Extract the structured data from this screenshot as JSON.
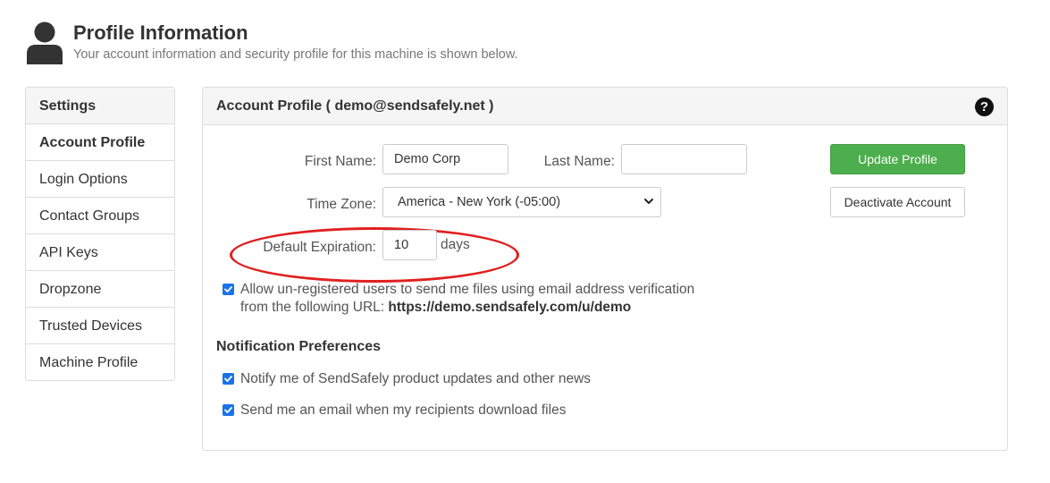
{
  "header": {
    "title": "Profile Information",
    "subtitle": "Your account information and security profile for this machine is shown below."
  },
  "sidebar": {
    "heading": "Settings",
    "items": [
      {
        "label": "Account Profile"
      },
      {
        "label": "Login Options"
      },
      {
        "label": "Contact Groups"
      },
      {
        "label": "API Keys"
      },
      {
        "label": "Dropzone"
      },
      {
        "label": "Trusted Devices"
      },
      {
        "label": "Machine Profile"
      }
    ]
  },
  "panel": {
    "title": "Account Profile ( demo@sendsafely.net )",
    "help_icon_glyph": "?",
    "form": {
      "first_name_label": "First Name:",
      "first_name_value": "Demo Corp",
      "last_name_label": "Last Name:",
      "last_name_value": "",
      "time_zone_label": "Time Zone:",
      "time_zone_value": "America - New York (-05:00)",
      "default_expiration_label": "Default Expiration:",
      "default_expiration_value": "10",
      "default_expiration_unit": "days"
    },
    "buttons": {
      "update_profile": "Update Profile",
      "deactivate_account": "Deactivate Account"
    },
    "allow_unregistered": {
      "checked": true,
      "line1": "Allow un-registered users to send me files using email address verification",
      "line2_prefix": "from the following URL:",
      "url": "https://demo.sendsafely.com/u/demo"
    },
    "notifications": {
      "title": "Notification Preferences",
      "items": [
        {
          "label": "Notify me of SendSafely product updates and other news",
          "checked": true
        },
        {
          "label": "Send me an email when my recipients download files",
          "checked": true
        }
      ]
    }
  },
  "colors": {
    "success": "#4cae4c",
    "checkbox": "#1a73e8",
    "highlight": "#e02020"
  }
}
